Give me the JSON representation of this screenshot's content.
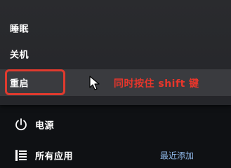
{
  "power_menu": {
    "items": [
      {
        "label": "睡眠"
      },
      {
        "label": "关机"
      },
      {
        "label": "重启"
      }
    ]
  },
  "annotation": {
    "text": "同时按住 shift 键",
    "color": "#e8362b"
  },
  "start": {
    "power_label": "电源",
    "all_apps_label": "所有应用",
    "recently_added_label": "最近添加"
  },
  "icons": {
    "power": "power-icon",
    "apps": "app-list-icon",
    "cursor": "mouse-cursor-icon"
  }
}
